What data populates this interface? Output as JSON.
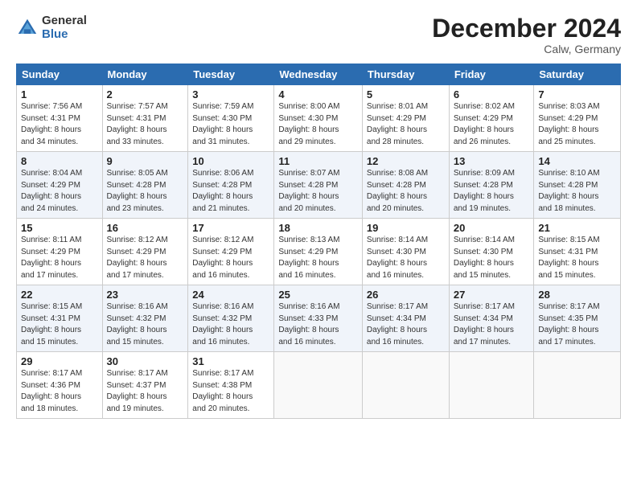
{
  "header": {
    "logo_general": "General",
    "logo_blue": "Blue",
    "month_title": "December 2024",
    "location": "Calw, Germany"
  },
  "days_of_week": [
    "Sunday",
    "Monday",
    "Tuesday",
    "Wednesday",
    "Thursday",
    "Friday",
    "Saturday"
  ],
  "weeks": [
    [
      {
        "day": "1",
        "info": "Sunrise: 7:56 AM\nSunset: 4:31 PM\nDaylight: 8 hours\nand 34 minutes."
      },
      {
        "day": "2",
        "info": "Sunrise: 7:57 AM\nSunset: 4:31 PM\nDaylight: 8 hours\nand 33 minutes."
      },
      {
        "day": "3",
        "info": "Sunrise: 7:59 AM\nSunset: 4:30 PM\nDaylight: 8 hours\nand 31 minutes."
      },
      {
        "day": "4",
        "info": "Sunrise: 8:00 AM\nSunset: 4:30 PM\nDaylight: 8 hours\nand 29 minutes."
      },
      {
        "day": "5",
        "info": "Sunrise: 8:01 AM\nSunset: 4:29 PM\nDaylight: 8 hours\nand 28 minutes."
      },
      {
        "day": "6",
        "info": "Sunrise: 8:02 AM\nSunset: 4:29 PM\nDaylight: 8 hours\nand 26 minutes."
      },
      {
        "day": "7",
        "info": "Sunrise: 8:03 AM\nSunset: 4:29 PM\nDaylight: 8 hours\nand 25 minutes."
      }
    ],
    [
      {
        "day": "8",
        "info": "Sunrise: 8:04 AM\nSunset: 4:29 PM\nDaylight: 8 hours\nand 24 minutes."
      },
      {
        "day": "9",
        "info": "Sunrise: 8:05 AM\nSunset: 4:28 PM\nDaylight: 8 hours\nand 23 minutes."
      },
      {
        "day": "10",
        "info": "Sunrise: 8:06 AM\nSunset: 4:28 PM\nDaylight: 8 hours\nand 21 minutes."
      },
      {
        "day": "11",
        "info": "Sunrise: 8:07 AM\nSunset: 4:28 PM\nDaylight: 8 hours\nand 20 minutes."
      },
      {
        "day": "12",
        "info": "Sunrise: 8:08 AM\nSunset: 4:28 PM\nDaylight: 8 hours\nand 20 minutes."
      },
      {
        "day": "13",
        "info": "Sunrise: 8:09 AM\nSunset: 4:28 PM\nDaylight: 8 hours\nand 19 minutes."
      },
      {
        "day": "14",
        "info": "Sunrise: 8:10 AM\nSunset: 4:28 PM\nDaylight: 8 hours\nand 18 minutes."
      }
    ],
    [
      {
        "day": "15",
        "info": "Sunrise: 8:11 AM\nSunset: 4:29 PM\nDaylight: 8 hours\nand 17 minutes."
      },
      {
        "day": "16",
        "info": "Sunrise: 8:12 AM\nSunset: 4:29 PM\nDaylight: 8 hours\nand 17 minutes."
      },
      {
        "day": "17",
        "info": "Sunrise: 8:12 AM\nSunset: 4:29 PM\nDaylight: 8 hours\nand 16 minutes."
      },
      {
        "day": "18",
        "info": "Sunrise: 8:13 AM\nSunset: 4:29 PM\nDaylight: 8 hours\nand 16 minutes."
      },
      {
        "day": "19",
        "info": "Sunrise: 8:14 AM\nSunset: 4:30 PM\nDaylight: 8 hours\nand 16 minutes."
      },
      {
        "day": "20",
        "info": "Sunrise: 8:14 AM\nSunset: 4:30 PM\nDaylight: 8 hours\nand 15 minutes."
      },
      {
        "day": "21",
        "info": "Sunrise: 8:15 AM\nSunset: 4:31 PM\nDaylight: 8 hours\nand 15 minutes."
      }
    ],
    [
      {
        "day": "22",
        "info": "Sunrise: 8:15 AM\nSunset: 4:31 PM\nDaylight: 8 hours\nand 15 minutes."
      },
      {
        "day": "23",
        "info": "Sunrise: 8:16 AM\nSunset: 4:32 PM\nDaylight: 8 hours\nand 15 minutes."
      },
      {
        "day": "24",
        "info": "Sunrise: 8:16 AM\nSunset: 4:32 PM\nDaylight: 8 hours\nand 16 minutes."
      },
      {
        "day": "25",
        "info": "Sunrise: 8:16 AM\nSunset: 4:33 PM\nDaylight: 8 hours\nand 16 minutes."
      },
      {
        "day": "26",
        "info": "Sunrise: 8:17 AM\nSunset: 4:34 PM\nDaylight: 8 hours\nand 16 minutes."
      },
      {
        "day": "27",
        "info": "Sunrise: 8:17 AM\nSunset: 4:34 PM\nDaylight: 8 hours\nand 17 minutes."
      },
      {
        "day": "28",
        "info": "Sunrise: 8:17 AM\nSunset: 4:35 PM\nDaylight: 8 hours\nand 17 minutes."
      }
    ],
    [
      {
        "day": "29",
        "info": "Sunrise: 8:17 AM\nSunset: 4:36 PM\nDaylight: 8 hours\nand 18 minutes."
      },
      {
        "day": "30",
        "info": "Sunrise: 8:17 AM\nSunset: 4:37 PM\nDaylight: 8 hours\nand 19 minutes."
      },
      {
        "day": "31",
        "info": "Sunrise: 8:17 AM\nSunset: 4:38 PM\nDaylight: 8 hours\nand 20 minutes."
      },
      null,
      null,
      null,
      null
    ]
  ]
}
